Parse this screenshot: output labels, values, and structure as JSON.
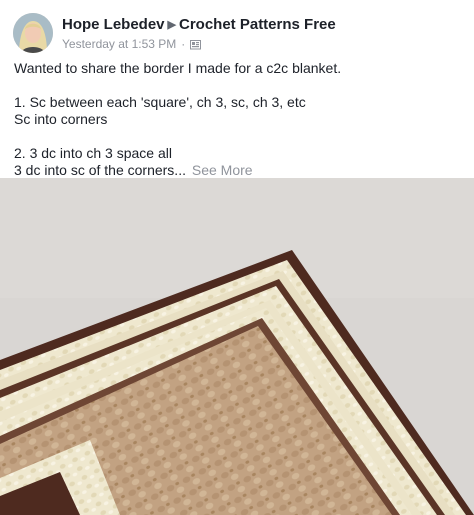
{
  "post": {
    "author": "Hope Lebedev",
    "group": "Crochet Patterns Free",
    "timestamp": "Yesterday at 1:53 PM",
    "meta_separator": "·",
    "privacy_icon": "group-privacy-icon",
    "text_lines": [
      "Wanted to share the border I made for a c2c blanket.",
      "1. Sc between each 'square', ch 3, sc, ch 3, etc",
      "Sc into corners",
      "2. 3 dc into ch 3 space all",
      "3 dc into sc of the corners..."
    ],
    "see_more": "See More"
  },
  "photo": {
    "subject": "crochet-blanket-corner-image",
    "colors": {
      "background": "#d9d6d3",
      "center_tan": "#c2a282",
      "cream": "#efe8cf",
      "brown_border": "#4e2a1f"
    }
  }
}
